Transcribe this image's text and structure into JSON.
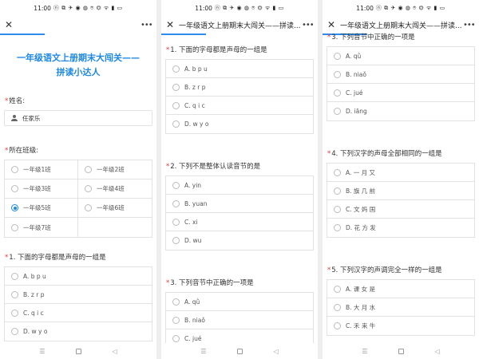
{
  "phones": [
    {
      "status": {
        "time": "11:00",
        "icons": "ⓝ ⧉ ✈ ◉ ◍ ⌾ ⏣ ᯤ ▮ ▭"
      },
      "title": "",
      "form_title": "一年级语文上册期末大闯关——拼读小达人",
      "name_label": "姓名:",
      "name_value": "任家乐",
      "class_label": "所在班级:",
      "class_options": [
        "一年级1班",
        "一年级2班",
        "一年级3班",
        "一年级4班",
        "一年级5班",
        "一年级6班",
        "一年级7班"
      ],
      "class_selected": 4,
      "questions": [
        {
          "title": "1. 下面的字母都是声母的一组是",
          "options": [
            "A. b p u",
            "B. z r p",
            "C. q i c",
            "D. w y o"
          ]
        }
      ]
    },
    {
      "status": {
        "time": "11:00",
        "icons": "ⓝ ⧉ ✈ ◉ ◍ ⌾ ⏣ ᯤ ▮ ▭"
      },
      "title": "一年级语文上册期末大闯关——拼读...",
      "questions": [
        {
          "title": "1. 下面的字母都是声母的一组是",
          "options": [
            "A. b p u",
            "B. z r p",
            "C. q i c",
            "D. w y o"
          ]
        },
        {
          "title": "2. 下列不是整体认读音节的是",
          "options": [
            "A. yin",
            "B. yuan",
            "C. xi",
            "D. wu"
          ]
        },
        {
          "title": "3. 下列音节中正确的一项是",
          "options": [
            "A. qǜ",
            "B. niaǒ",
            "C. jué"
          ]
        }
      ]
    },
    {
      "status": {
        "time": "11:00",
        "icons": "ⓝ ⧉ ✈ ◉ ◍ ⌾ ⏣ ᯤ ▮ ▭"
      },
      "title": "一年级语文上册期末大闯关——拼读...",
      "questions": [
        {
          "title": "3. 下列音节中正确的一项是",
          "options": [
            "A. qǜ",
            "B. niaǒ",
            "C. jué",
            "D. iāng"
          ]
        },
        {
          "title": "4. 下列汉字的声母全部相同的一组是",
          "options": [
            "A. 一 月 又",
            "B. 旗 几 前",
            "C. 文 妈 国",
            "D. 花 方 发"
          ]
        },
        {
          "title": "5. 下列汉字的声调完全一样的一组是",
          "options": [
            "A. 课 女 是",
            "B. 大 月 水",
            "C. 禾 来 牛"
          ]
        }
      ]
    }
  ],
  "nav": {
    "menu_icon": "menu-icon",
    "home_icon": "home-icon",
    "back_icon": "back-icon"
  },
  "colors": {
    "accent": "#1e88e5",
    "required": "#e53935"
  }
}
